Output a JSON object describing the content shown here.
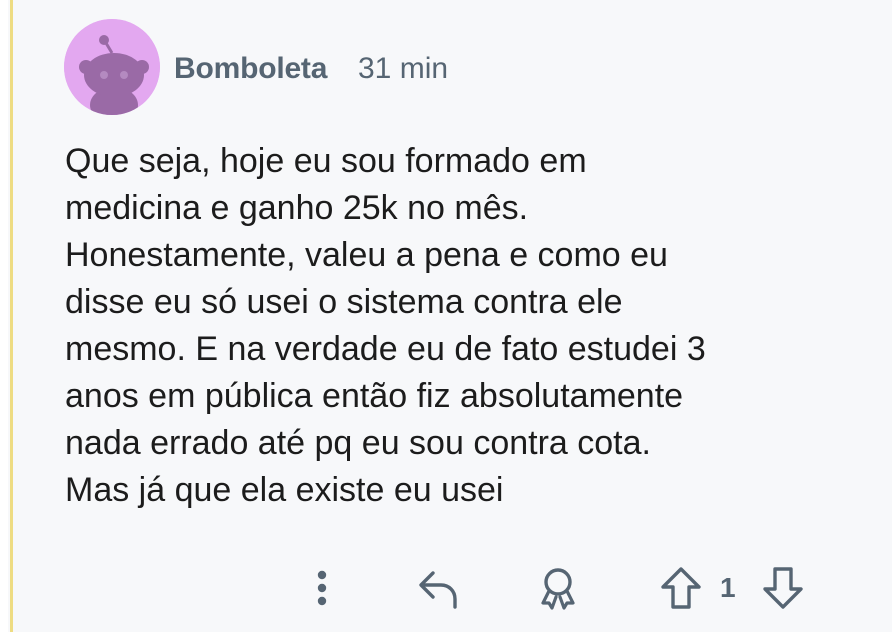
{
  "comment": {
    "author": "Bomboleta",
    "time": "31 min",
    "avatar_color": "#e3a8f0",
    "body_lines": [
      "Que seja, hoje eu sou formado em",
      "medicina e ganho 25k no mês.",
      "Honestamente, valeu a pena e como eu",
      "disse eu só usei o sistema contra ele",
      "mesmo. E na verdade eu de fato estudei 3",
      "anos em pública então fiz absolutamente",
      "nada errado até pq eu sou contra cota.",
      "Mas já que ela existe eu usei"
    ]
  },
  "actions": {
    "more_icon": "more-vertical-icon",
    "reply_icon": "reply-arrow-icon",
    "award_icon": "award-icon",
    "upvote_icon": "upvote-arrow-icon",
    "vote_count": "1",
    "downvote_icon": "downvote-arrow-icon"
  },
  "colors": {
    "background": "#f7f8fa",
    "thread_line": "#eedc82",
    "meta_text": "#566573",
    "body_text": "#1c1c1c"
  }
}
